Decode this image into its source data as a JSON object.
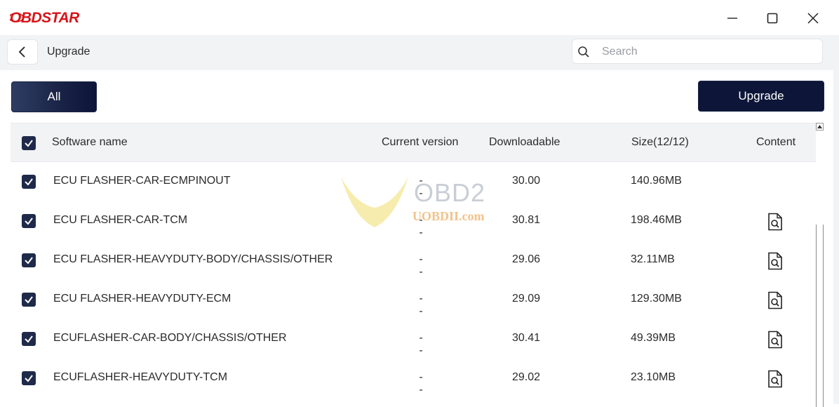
{
  "app": {
    "logo_text": "OBDSTAR"
  },
  "window": {
    "minimize_icon": "minimize-icon",
    "maximize_icon": "maximize-icon",
    "close_icon": "close-icon"
  },
  "nav": {
    "back_icon": "chevron-left-icon",
    "title": "Upgrade"
  },
  "search": {
    "placeholder": "Search",
    "value": "",
    "icon": "search-icon"
  },
  "actions": {
    "all_label": "All",
    "upgrade_label": "Upgrade"
  },
  "table": {
    "headers": {
      "name": "Software name",
      "current": "Current version",
      "downloadable": "Downloadable",
      "size": "Size(12/12)",
      "content": "Content"
    },
    "header_checked": true,
    "rows": [
      {
        "name": "ECU FLASHER-CAR-ECMPINOUT",
        "current": "--",
        "downloadable": "30.00",
        "size": "140.96MB",
        "checked": true,
        "has_content": false
      },
      {
        "name": "ECU FLASHER-CAR-TCM",
        "current": "--",
        "downloadable": "30.81",
        "size": "198.46MB",
        "checked": true,
        "has_content": true
      },
      {
        "name": "ECU FLASHER-HEAVYDUTY-BODY/CHASSIS/OTHER",
        "current": "--",
        "downloadable": "29.06",
        "size": "32.11MB",
        "checked": true,
        "has_content": true
      },
      {
        "name": "ECU FLASHER-HEAVYDUTY-ECM",
        "current": "--",
        "downloadable": "29.09",
        "size": "129.30MB",
        "checked": true,
        "has_content": true
      },
      {
        "name": "ECUFLASHER-CAR-BODY/CHASSIS/OTHER",
        "current": "--",
        "downloadable": "30.41",
        "size": "49.39MB",
        "checked": true,
        "has_content": true
      },
      {
        "name": "ECUFLASHER-HEAVYDUTY-TCM",
        "current": "--",
        "downloadable": "29.02",
        "size": "23.10MB",
        "checked": true,
        "has_content": true
      }
    ],
    "content_icon": "document-search-icon"
  },
  "watermark": {
    "line1": "OBD2",
    "line2": "UOBDII.com"
  },
  "colors": {
    "brand_red": "#d7141a",
    "accent_navy": "#1a2447",
    "checkbox": "#1f2a4a"
  }
}
